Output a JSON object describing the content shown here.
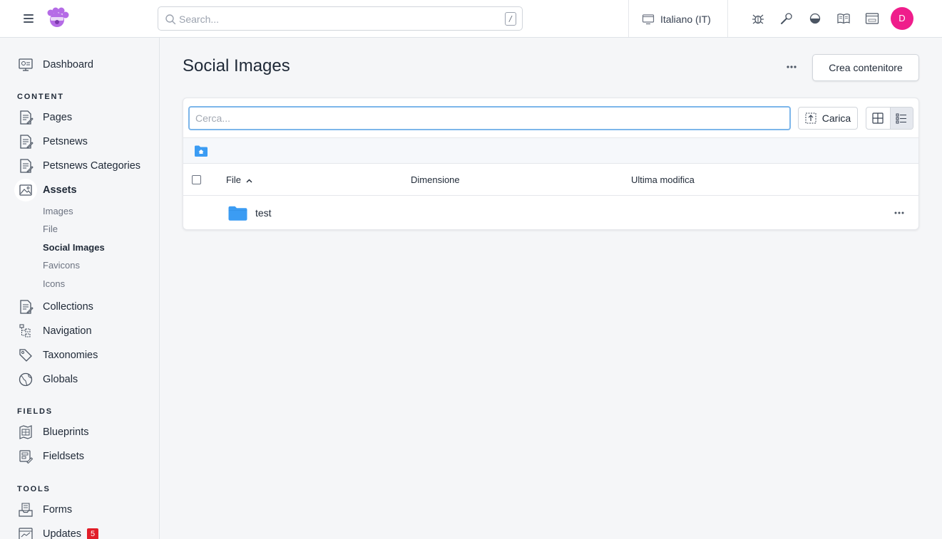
{
  "topbar": {
    "search_placeholder": "Search...",
    "search_shortcut": "/",
    "site_label": "Italiano (IT)",
    "user_initial": "D"
  },
  "sidebar": {
    "dashboard": "Dashboard",
    "sections": {
      "content": "CONTENT",
      "fields": "FIELDS",
      "tools": "TOOLS"
    },
    "content_items": [
      "Pages",
      "Petsnews",
      "Petsnews Categories",
      "Assets"
    ],
    "asset_children": [
      "Images",
      "File",
      "Social Images",
      "Favicons",
      "Icons"
    ],
    "content_items_2": [
      "Collections",
      "Navigation",
      "Taxonomies",
      "Globals"
    ],
    "fields_items": [
      "Blueprints",
      "Fieldsets"
    ],
    "tools_items": [
      "Forms",
      "Updates"
    ],
    "updates_badge": "5"
  },
  "main": {
    "title": "Social Images",
    "create_button": "Crea contenitore",
    "filter_placeholder": "Cerca...",
    "upload_button": "Carica",
    "columns": {
      "file": "File",
      "size": "Dimensione",
      "modified": "Ultima modifica"
    },
    "rows": [
      {
        "name": "test"
      }
    ]
  },
  "colors": {
    "accent": "#3b9cf3",
    "avatar": "#ef1d8b",
    "badge": "#e11d28",
    "focus_border": "#7db6ea"
  }
}
